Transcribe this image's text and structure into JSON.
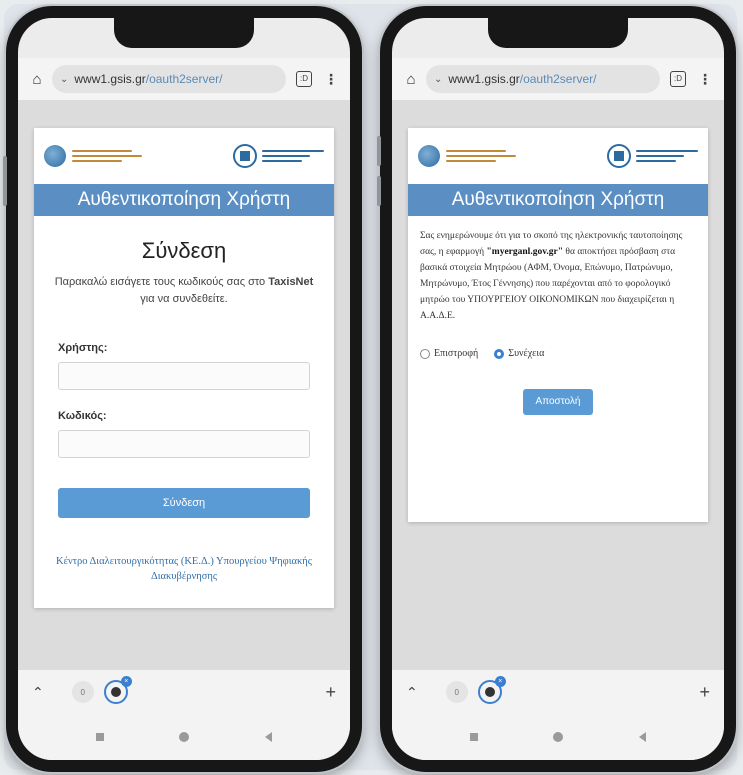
{
  "browser": {
    "url_domain": "www1.gsis.gr",
    "url_path": "/oauth2server/",
    "tabs_count": ":D"
  },
  "header": {
    "title": "Αυθεντικοποίηση Χρήστη"
  },
  "login": {
    "heading": "Σύνδεση",
    "description_prefix": "Παρακαλώ εισάγετε τους κωδικούς σας στο",
    "description_brand": "TaxisNet",
    "description_suffix": "για να συνδεθείτε.",
    "username_label": "Χρήστης:",
    "password_label": "Κωδικός:",
    "submit_label": "Σύνδεση",
    "footer": "Κέντρο Διαλειτουργικότητας (ΚΕ.Δ.) Υπουργείου Ψηφιακής Διακυβέρνησης"
  },
  "consent": {
    "text_part1": "Σας ενημερώνουμε ότι για το σκοπό της ηλεκτρονικής ταυτοποίησης σας, η εφαρμογή",
    "app_name": "\"myerganl.gov.gr\"",
    "text_part2": "θα αποκτήσει πρόσβαση στα βασικά στοιχεία Μητρώου (ΑΦΜ, Όνομα, Επώνυμο, Πατρώνυμο, Μητρώνυμο, Έτος Γέννησης) που παρέχονται από το φορολογικό μητρώο του ΥΠΟΥΡΓΕΙΟΥ ΟΙΚΟΝΟΜΙΚΩΝ που διαχειρίζεται η Α.Α.Δ.Ε.",
    "option_return": "Επιστροφή",
    "option_continue": "Συνέχεια",
    "submit_label": "Αποστολή"
  },
  "tabbar": {
    "badge": "0"
  }
}
